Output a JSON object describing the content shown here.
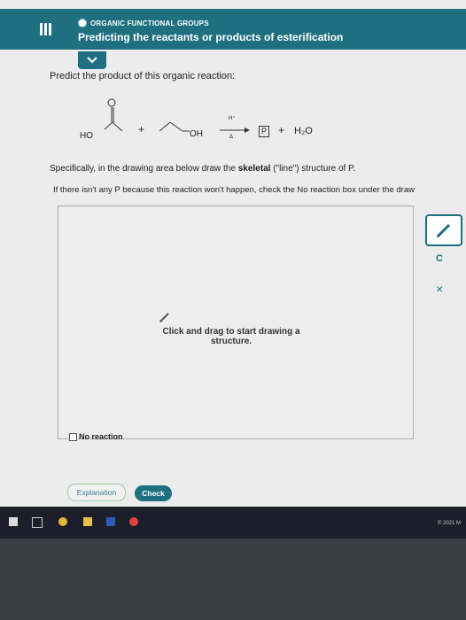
{
  "header": {
    "topic": "ORGANIC FUNCTIONAL GROUPS",
    "title": "Predicting the reactants or products of esterification",
    "expand_label": "✔"
  },
  "question": {
    "prompt": "Predict the product of this organic reaction:",
    "reaction": {
      "reactant1_label": "HO",
      "plus1": "+",
      "reactant2_label": "OH",
      "arrow_top": "H⁺",
      "arrow_bottom": "Δ",
      "product_box": "P",
      "plus2": "+",
      "byproduct": "H₂O"
    },
    "specifically_pre": "Specifically, in the drawing area below draw the ",
    "specifically_bold": "skeletal",
    "specifically_post": " (\"line\") structure of P.",
    "if_not": "If there isn't any P because this reaction won't happen, check the No reaction box under the draw"
  },
  "drawing": {
    "hint": "Click and drag to start drawing a structure.",
    "no_reaction_label": "No reaction"
  },
  "toolbar": {
    "c_label": "C",
    "close_label": "×"
  },
  "buttons": {
    "explanation": "Explanation",
    "check": "Check"
  },
  "taskbar": {
    "copyright": "© 2021 M"
  }
}
